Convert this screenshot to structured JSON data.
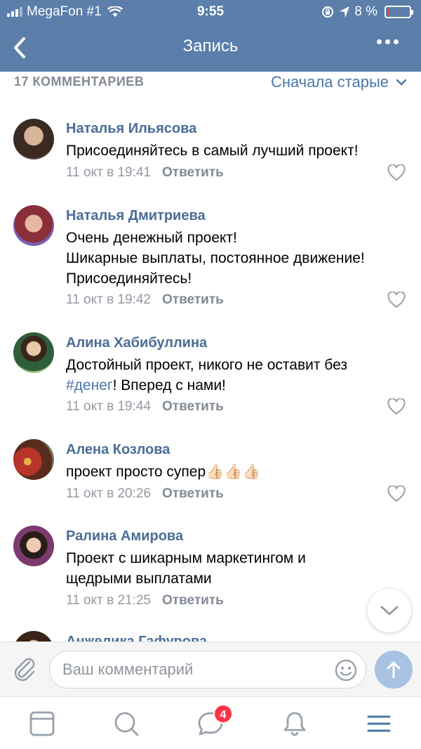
{
  "status_bar": {
    "carrier": "MegaFon #1",
    "time": "9:55",
    "battery": "8 %",
    "battery_level": 0.08
  },
  "header": {
    "title": "Запись"
  },
  "comments_header": {
    "count_label": "17 КОММЕНТАРИЕВ",
    "sort_label": "Сначала старые"
  },
  "comments": [
    {
      "author": "Наталья Ильясова",
      "lines": [
        "Присоединяйтесь в самый лучший проект!"
      ],
      "date": "11 окт в 19:41",
      "reply": "Ответить"
    },
    {
      "author": "Наталья Дмитриева",
      "lines": [
        "Очень денежный проект!",
        "Шикарные выплаты, постоянное движение!",
        "Присоединяйтесь!"
      ],
      "date": "11 окт в 19:42",
      "reply": "Ответить"
    },
    {
      "author": "Алина Хабибуллина",
      "line1": "Достойный проект, никого не оставит без",
      "hashtag": "#денег",
      "line2_rest": "! Вперед с нами!",
      "date": "11 окт в 19:44",
      "reply": "Ответить"
    },
    {
      "author": "Алена Козлова",
      "lines": [
        "проект просто супер👍🏻👍🏻👍🏻"
      ],
      "date": "11 окт в 20:26",
      "reply": "Ответить"
    },
    {
      "author": "Ралина Амирова",
      "lines": [
        "Проект с шикарным маркетингом и",
        "щедрыми выплатами"
      ],
      "date": "11 окт в 21:25",
      "reply": "Ответить"
    },
    {
      "author": "Анжелика Гафурова"
    }
  ],
  "composer": {
    "placeholder": "Ваш комментарий"
  },
  "tabbar": {
    "messages_badge": "4"
  }
}
